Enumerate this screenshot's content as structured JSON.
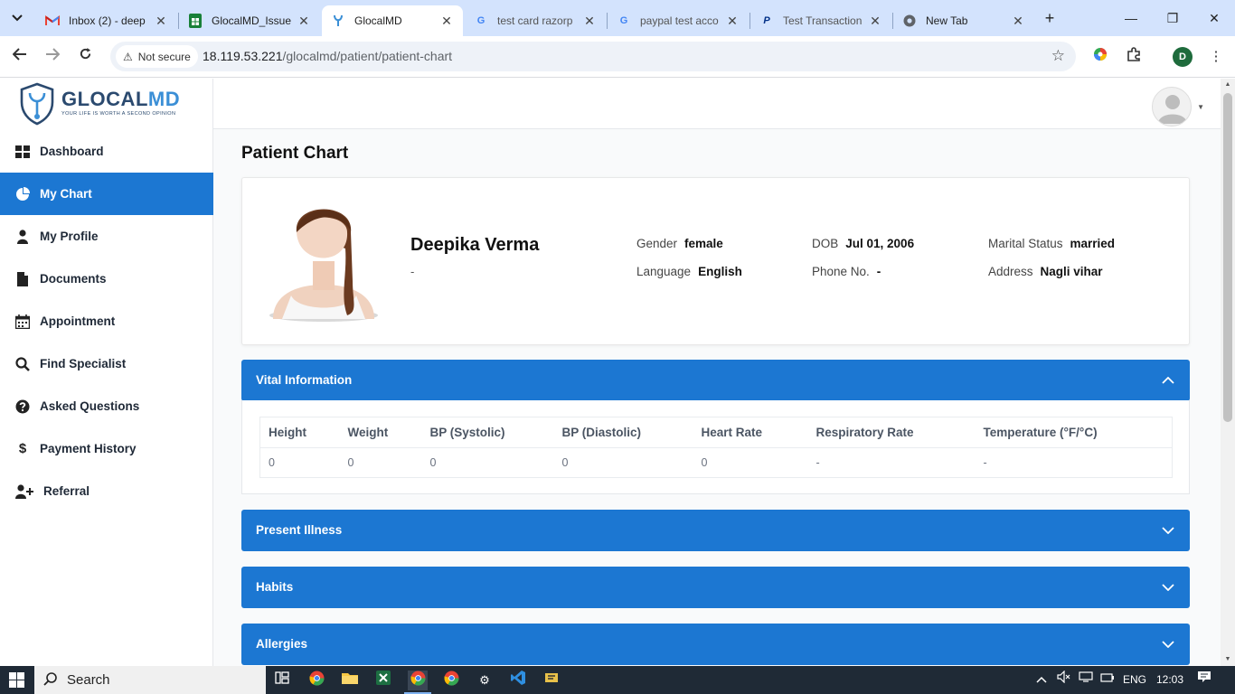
{
  "browser": {
    "tabs": [
      {
        "title": "Inbox (2) - deep",
        "favicon": "gmail-icon",
        "active": false
      },
      {
        "title": "GlocalMD_Issue",
        "favicon": "sheets-icon",
        "active": false
      },
      {
        "title": "GlocalMD",
        "favicon": "glocalmd-icon",
        "active": true
      },
      {
        "title": "test card razorp",
        "favicon": "google-icon",
        "active": false
      },
      {
        "title": "paypal test acco",
        "favicon": "google-icon",
        "active": false
      },
      {
        "title": "Test Transaction",
        "favicon": "paypal-icon",
        "active": false
      },
      {
        "title": "New Tab",
        "favicon": "chrome-icon",
        "active": false
      }
    ],
    "security_label": "Not secure",
    "url_host": "18.119.53.221",
    "url_path": "/glocalmd/patient/patient-chart",
    "profile_initial": "D"
  },
  "app": {
    "logo_text_a": "GLOCAL",
    "logo_text_b": "MD",
    "logo_tagline": "YOUR LIFE IS WORTH A SECOND OPINION"
  },
  "sidebar": {
    "items": [
      {
        "label": "Dashboard",
        "icon": "dashboard-icon",
        "active": false
      },
      {
        "label": "My Chart",
        "icon": "pie-chart-icon",
        "active": true
      },
      {
        "label": "My Profile",
        "icon": "user-icon",
        "active": false
      },
      {
        "label": "Documents",
        "icon": "file-icon",
        "active": false
      },
      {
        "label": "Appointment",
        "icon": "calendar-icon",
        "active": false
      },
      {
        "label": "Find Specialist",
        "icon": "search-icon",
        "active": false
      },
      {
        "label": "Asked Questions",
        "icon": "question-icon",
        "active": false
      },
      {
        "label": "Payment History",
        "icon": "dollar-icon",
        "active": false
      },
      {
        "label": "Referral",
        "icon": "user-plus-icon",
        "active": false
      }
    ]
  },
  "page": {
    "title": "Patient Chart"
  },
  "patient": {
    "name": "Deepika Verma",
    "subtitle": "-",
    "gender_label": "Gender",
    "gender": "female",
    "dob_label": "DOB",
    "dob": "Jul 01, 2006",
    "marital_label": "Marital Status",
    "marital": "married",
    "language_label": "Language",
    "language": "English",
    "phone_label": "Phone No.",
    "phone": "-",
    "address_label": "Address",
    "address": "Nagli vihar"
  },
  "vitals": {
    "title": "Vital Information",
    "headers": [
      "Height",
      "Weight",
      "BP (Systolic)",
      "BP (Diastolic)",
      "Heart Rate",
      "Respiratory Rate",
      "Temperature (°F/°C)"
    ],
    "values": [
      "0",
      "0",
      "0",
      "0",
      "0",
      "-",
      "-"
    ]
  },
  "panels": [
    {
      "title": "Present Illness"
    },
    {
      "title": "Habits"
    },
    {
      "title": "Allergies"
    }
  ],
  "taskbar": {
    "search_placeholder": "Search",
    "language": "ENG",
    "time": "12:03"
  },
  "colors": {
    "primary": "#1c77d2",
    "tabstrip": "#d3e3fd",
    "taskbar": "#1f2a36"
  }
}
